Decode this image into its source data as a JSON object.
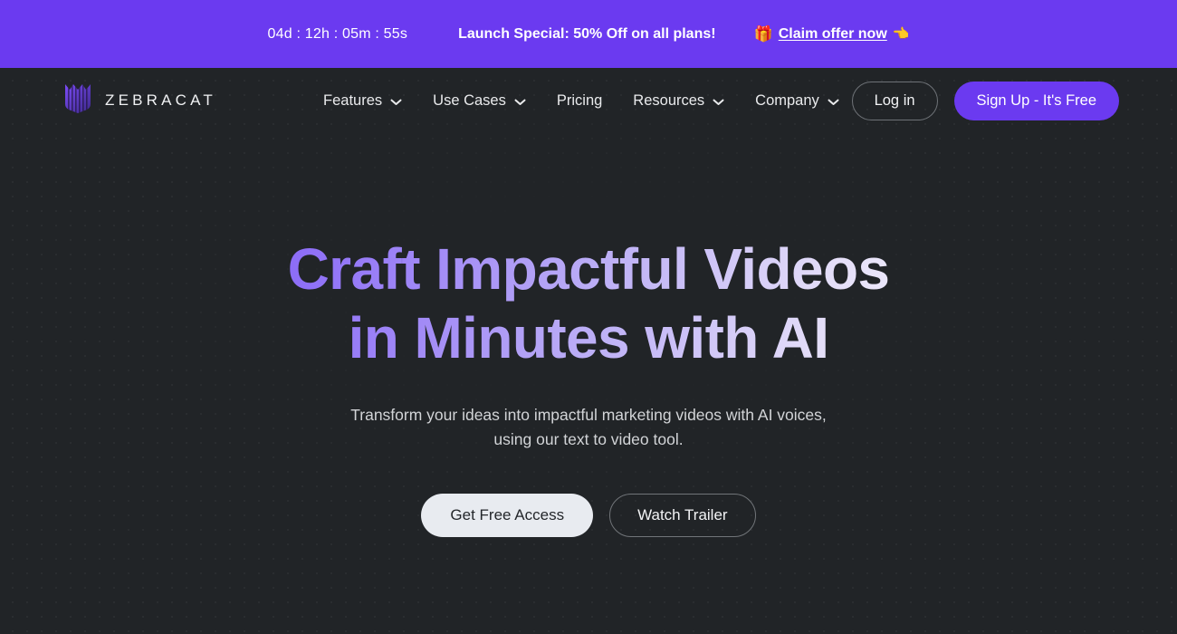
{
  "colors": {
    "banner_purple": "#6B3AF0",
    "page_background": "#212427",
    "accent": "#6B3AF0",
    "primary_button": "#E8EBF0",
    "headline_gradient_start": "#6F47F5",
    "headline_gradient_end": "#FFFFFF"
  },
  "banner": {
    "countdown": "04d : 12h : 05m : 55s",
    "message": "Launch Special: 50% Off on all plans!",
    "gift_emoji": "🎁",
    "cta_label": "Claim offer now",
    "hand_emoji": "👈"
  },
  "nav": {
    "brand": "ZEBRACAT",
    "items": [
      {
        "label": "Features",
        "has_dropdown": true
      },
      {
        "label": "Use Cases",
        "has_dropdown": true
      },
      {
        "label": "Pricing",
        "has_dropdown": false
      },
      {
        "label": "Resources",
        "has_dropdown": true
      },
      {
        "label": "Company",
        "has_dropdown": true
      }
    ],
    "login_label": "Log in",
    "signup_label": "Sign Up - It's Free"
  },
  "hero": {
    "title_line1": "Craft Impactful Videos",
    "title_line2": "in Minutes with AI",
    "sub_line1": "Transform your ideas into impactful marketing videos with AI voices,",
    "sub_line2": "using our text to video tool.",
    "primary_cta": "Get Free Access",
    "secondary_cta": "Watch Trailer"
  }
}
